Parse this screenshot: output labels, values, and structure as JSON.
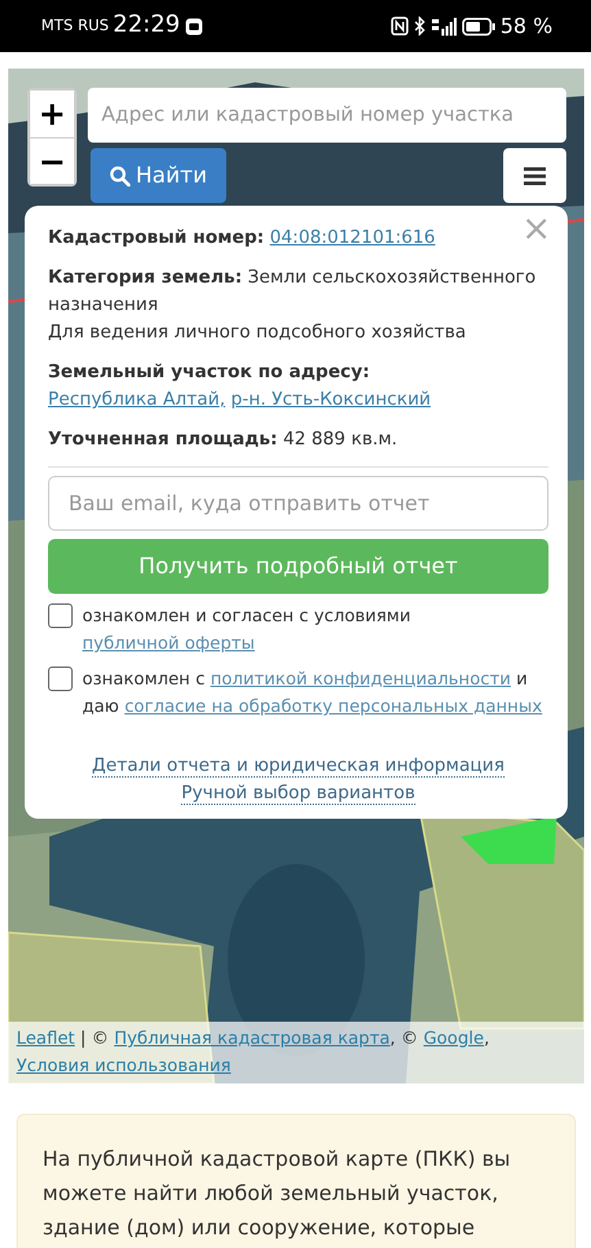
{
  "status_bar": {
    "carrier": "MTS RUS",
    "time": "22:29",
    "battery": "58 %"
  },
  "map": {
    "zoom_in": "+",
    "zoom_out": "−",
    "search": {
      "placeholder": "Адрес или кадастровый номер участка"
    },
    "search_button": "Найти"
  },
  "popup": {
    "close": "×",
    "rows": [
      {
        "kind": "link",
        "label": "Кадастровый номер:",
        "value": "04:08:012101:616"
      },
      {
        "kind": "text",
        "label": "Категория земель:",
        "value": "Земли сельскохозяйственного назначения",
        "note": "Для ведения личного подсобного хозяйства"
      },
      {
        "kind": "link",
        "label": "Земельный участок по адресу:",
        "value": "Республика Алтай, р-н. Усть-Коксинский"
      },
      {
        "kind": "text",
        "label": "Уточненная площадь:",
        "value": "42 889 кв.м."
      }
    ],
    "email": {
      "placeholder": "Ваш email, куда отправить отчет"
    },
    "submit": "Получить подробный отчет",
    "consents": [
      {
        "checked": false,
        "parts": [
          {
            "text": "ознакомлен и согласен с условиями",
            "kind": "text"
          },
          {
            "text": "публичной оферты",
            "kind": "link"
          }
        ]
      },
      {
        "checked": false,
        "parts": [
          {
            "text": "ознакомлен с",
            "kind": "text"
          },
          {
            "text": "политикой конфиденциальности",
            "kind": "link"
          },
          {
            "text": "и даю",
            "kind": "text"
          },
          {
            "text": "согласие на обработку персональных данных",
            "kind": "link"
          }
        ]
      }
    ],
    "links": [
      "Детали отчета и юридическая информация",
      "Ручной выбор вариантов"
    ]
  },
  "attribution": [
    {
      "text": "Leaflet",
      "kind": "link"
    },
    {
      "text": "| ©",
      "kind": "text"
    },
    {
      "text": "Публичная кадастровая карта",
      "kind": "link"
    },
    {
      "text": ", ©",
      "kind": "text"
    },
    {
      "text": "Google",
      "kind": "link"
    },
    {
      "text": ",",
      "kind": "text"
    },
    {
      "text": "Условия использования",
      "kind": "link"
    }
  ],
  "info": [
    "На публичной кадастровой карте (ПКК) вы",
    "можете найти любой земельный участок,",
    "здание (дом) или сооружение, которые"
  ]
}
